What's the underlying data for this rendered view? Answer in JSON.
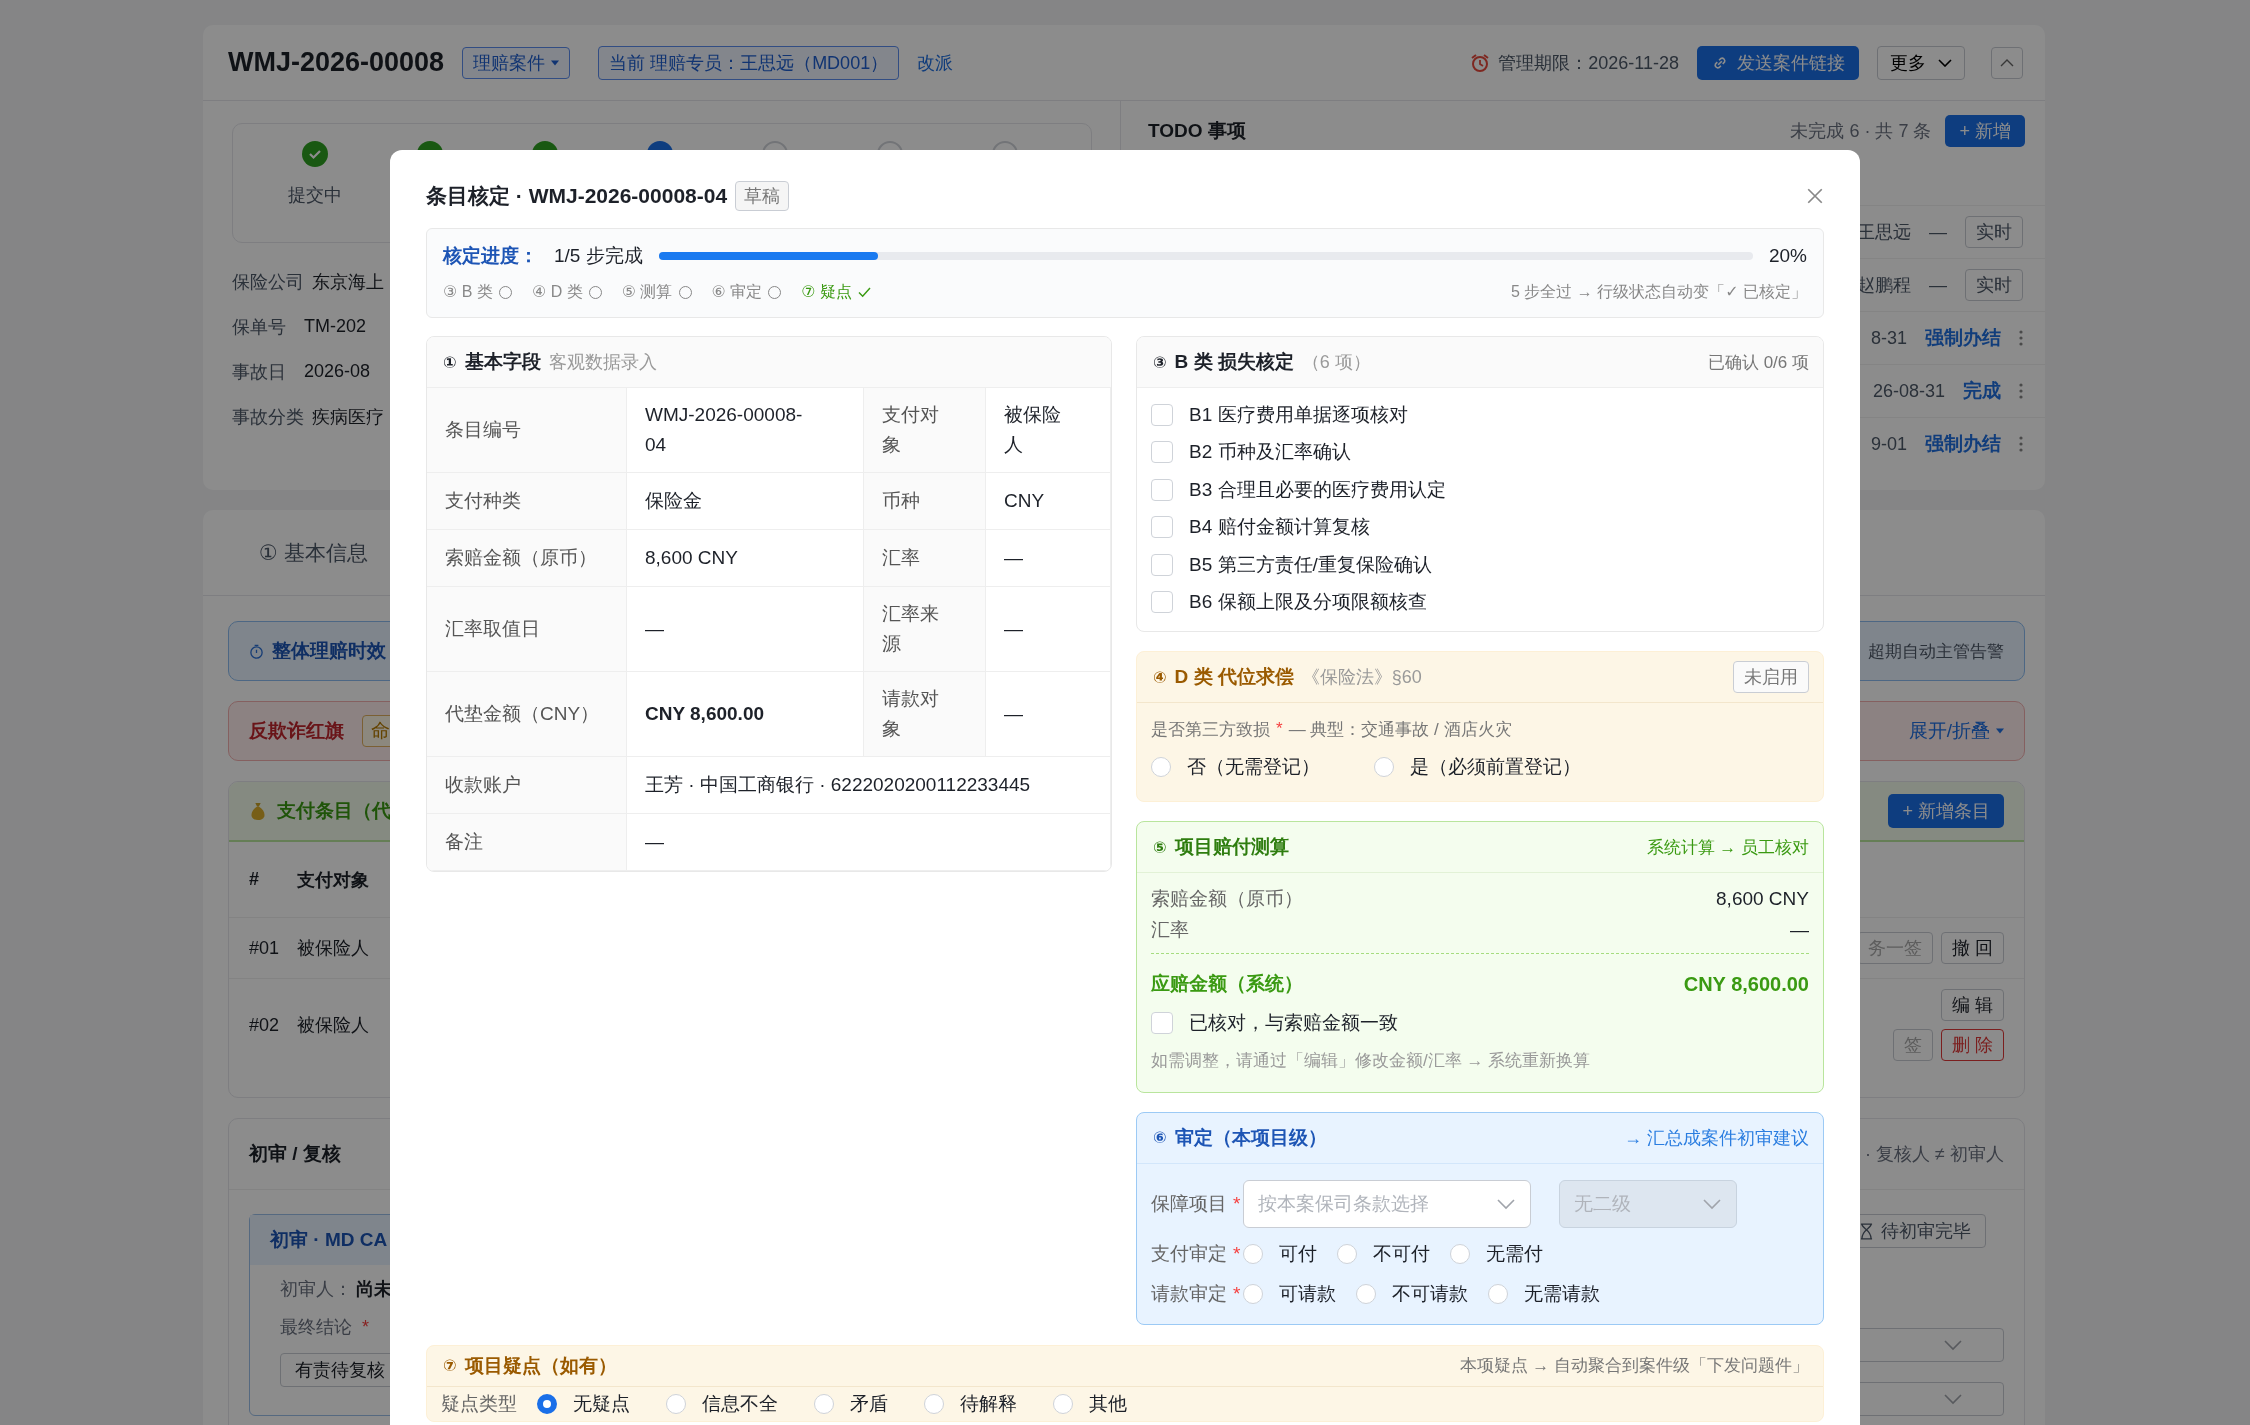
{
  "case_header": {
    "title": "WMJ-2026-00008",
    "type_tag": "理赔案件",
    "handler_tag": "当前 理赔专员：王思远（MD001）",
    "reassign_link": "改派",
    "deadline": "管理期限：2026-11-28",
    "send_button": "发送案件链接",
    "more_button": "更多"
  },
  "stepper": {
    "steps": [
      {
        "done": true,
        "current": false,
        "label": "提交中"
      },
      {
        "done": true,
        "current": false
      },
      {
        "done": true,
        "current": false
      },
      {
        "done": false,
        "current": true
      },
      {
        "done": false,
        "current": false
      },
      {
        "done": false,
        "current": false
      },
      {
        "done": false,
        "current": false
      }
    ]
  },
  "case_info": [
    {
      "label": "保险公司",
      "value": "东京海上"
    },
    {
      "label": "保单号",
      "value": "TM-202"
    },
    {
      "label": "事故日",
      "value": "2026-08"
    },
    {
      "label": "事故分类",
      "value": "疾病医疗"
    }
  ],
  "todo": {
    "title": "TODO 事项",
    "summary": "未完成 6 · 共 7 条",
    "add_button": "+ 新增",
    "rows": [
      {
        "kind": "tag",
        "text": "王思远",
        "sep": "—",
        "tag": "实时"
      },
      {
        "kind": "tag",
        "text": "赵鹏程",
        "sep": "—",
        "tag": "实时"
      },
      {
        "kind": "action",
        "text": "8-31",
        "action": "强制办结"
      },
      {
        "kind": "action",
        "text": "26-08-31",
        "action": "完成"
      },
      {
        "kind": "action",
        "text": "9-01",
        "action": "强制办结"
      }
    ]
  },
  "tabs": [
    {
      "label": "① 基本信息"
    }
  ],
  "alerts": [
    {
      "kind": "info",
      "title": "整体理赔时效",
      "right": "超期自动主管告警"
    },
    {
      "kind": "danger",
      "title": "反欺诈红旗",
      "tag": "命",
      "right": "展开/折叠"
    }
  ],
  "payment_items": {
    "title": "支付条目（代",
    "add_button": "+ 新增条目",
    "columns": [
      "#",
      "支付对象"
    ],
    "rows": [
      {
        "no": "#01",
        "payee": "被保险人",
        "actions": [
          {
            "label": "务一签",
            "kind": "muted"
          },
          {
            "label": "撤 回",
            "kind": "default"
          }
        ]
      },
      {
        "no": "#02",
        "payee": "被保险人",
        "actions": [
          {
            "label": "编 辑",
            "kind": "default"
          }
        ],
        "actions_2": [
          {
            "label": "签",
            "kind": "muted"
          },
          {
            "label": "删 除",
            "kind": "danger"
          }
        ]
      }
    ]
  },
  "review": {
    "title": "初审 / 复核",
    "note": "· 复核人 ≠ 初审人",
    "first": {
      "title": "初审 · MD CA",
      "reviewer_label": "初审人：",
      "reviewer": "尚未",
      "conclusion_label": "最终结论",
      "mark": "*",
      "conclusion_value": "有责待复核"
    },
    "second": {
      "status_button": "待初审完毕"
    }
  },
  "modal": {
    "title": "条目核定 · WMJ-2026-00008-04",
    "status_tag": "草稿",
    "progress": {
      "label": "核定进度：",
      "text": "1/5 步完成",
      "level": 0.2,
      "percent": "20%",
      "hint": "5 步全过 → 行级状态自动变「✓ 已核定」",
      "steps": [
        {
          "label": "③ B 类",
          "done": false
        },
        {
          "label": "④ D 类",
          "done": false
        },
        {
          "label": "⑤ 测算",
          "done": false
        },
        {
          "label": "⑥ 审定",
          "done": false
        },
        {
          "label": "⑦ 疑点",
          "done": true
        }
      ]
    },
    "basic_fields": {
      "number": "①",
      "title": "基本字段",
      "subtitle": "客观数据录入",
      "rows": [
        {
          "cells": [
            {
              "label": "条目编号",
              "value": "WMJ-2026-00008-04"
            },
            {
              "label": "支付对象",
              "value": "被保险人"
            }
          ]
        },
        {
          "cells": [
            {
              "label": "支付种类",
              "value": "保险金"
            },
            {
              "label": "币种",
              "value": "CNY"
            }
          ]
        },
        {
          "cells": [
            {
              "label": "索赔金额（原币）",
              "value": "8,600 CNY"
            },
            {
              "label": "汇率",
              "value": "—"
            }
          ]
        },
        {
          "cells": [
            {
              "label": "汇率取值日",
              "value": "—"
            },
            {
              "label": "汇率来源",
              "value": "—"
            }
          ]
        },
        {
          "cells": [
            {
              "label": "代垫金额（CNY）",
              "value": "CNY 8,600.00",
              "strong": true
            },
            {
              "label": "请款对象",
              "value": "—"
            }
          ]
        },
        {
          "cells": [
            {
              "label": "收款账户",
              "value": "王芳 · 中国工商银行 · 6222020200112233445"
            }
          ]
        },
        {
          "cells": [
            {
              "label": "备注",
              "value": "—"
            }
          ]
        }
      ]
    },
    "b_check": {
      "number": "③",
      "title": "B 类 损失核定",
      "count": "（6 项）",
      "status": "已确认 0/6 项",
      "items": [
        {
          "label": "B1 医疗费用单据逐项核对",
          "checked": false
        },
        {
          "label": "B2 币种及汇率确认",
          "checked": false
        },
        {
          "label": "B3 合理且必要的医疗费用认定",
          "checked": false
        },
        {
          "label": "B4 赔付金额计算复核",
          "checked": false
        },
        {
          "label": "B5 第三方责任/重复保险确认",
          "checked": false
        },
        {
          "label": "B6 保额上限及分项限额核查",
          "checked": false
        }
      ]
    },
    "d_subrogation": {
      "number": "④",
      "title": "D 类 代位求偿",
      "law": "《保险法》§60",
      "status_tag": "未启用",
      "question": "是否第三方致损",
      "mark": "*",
      "hint": "— 典型：交通事故 / 酒店火灾",
      "options": [
        {
          "label": "否（无需登记）",
          "selected": false
        },
        {
          "label": "是（必须前置登记）",
          "selected": false
        }
      ]
    },
    "calc": {
      "number": "⑤",
      "title": "项目赔付测算",
      "flow": "系统计算 → 员工核对",
      "rows": [
        {
          "label": "索赔金额（原币）",
          "value": "8,600 CNY"
        },
        {
          "label": "汇率",
          "value": "—"
        }
      ],
      "total_label": "应赔金额（系统）",
      "total_value": "CNY 8,600.00",
      "confirm": {
        "label": "已核对，与索赔金额一致",
        "checked": false
      },
      "note": "如需调整，请通过「编辑」修改金额/汇率 → 系统重新换算"
    },
    "approval": {
      "number": "⑥",
      "title": "审定（本项目级）",
      "link": "→ 汇总成案件初审建议",
      "coverage": {
        "label": "保障项目",
        "mark": "*",
        "placeholder": "按本案保司条款选择",
        "secondary": {
          "placeholder": "无二级",
          "disabled": true
        }
      },
      "groups": [
        {
          "label": "支付审定",
          "mark": "*",
          "options": [
            {
              "label": "可付",
              "selected": false
            },
            {
              "label": "不可付",
              "selected": false
            },
            {
              "label": "无需付",
              "selected": false
            }
          ]
        },
        {
          "label": "请款审定",
          "mark": "*",
          "options": [
            {
              "label": "可请款",
              "selected": false
            },
            {
              "label": "不可请款",
              "selected": false
            },
            {
              "label": "无需请款",
              "selected": false
            }
          ]
        }
      ]
    },
    "doubt": {
      "number": "⑦",
      "title": "项目疑点（如有）",
      "flow": "本项疑点 → 自动聚合到案件级「下发问题件」",
      "type_label": "疑点类型",
      "options": [
        {
          "label": "无疑点",
          "selected": true
        },
        {
          "label": "信息不全",
          "selected": false
        },
        {
          "label": "矛盾",
          "selected": false
        },
        {
          "label": "待解释",
          "selected": false
        },
        {
          "label": "其他",
          "selected": false
        }
      ]
    }
  }
}
